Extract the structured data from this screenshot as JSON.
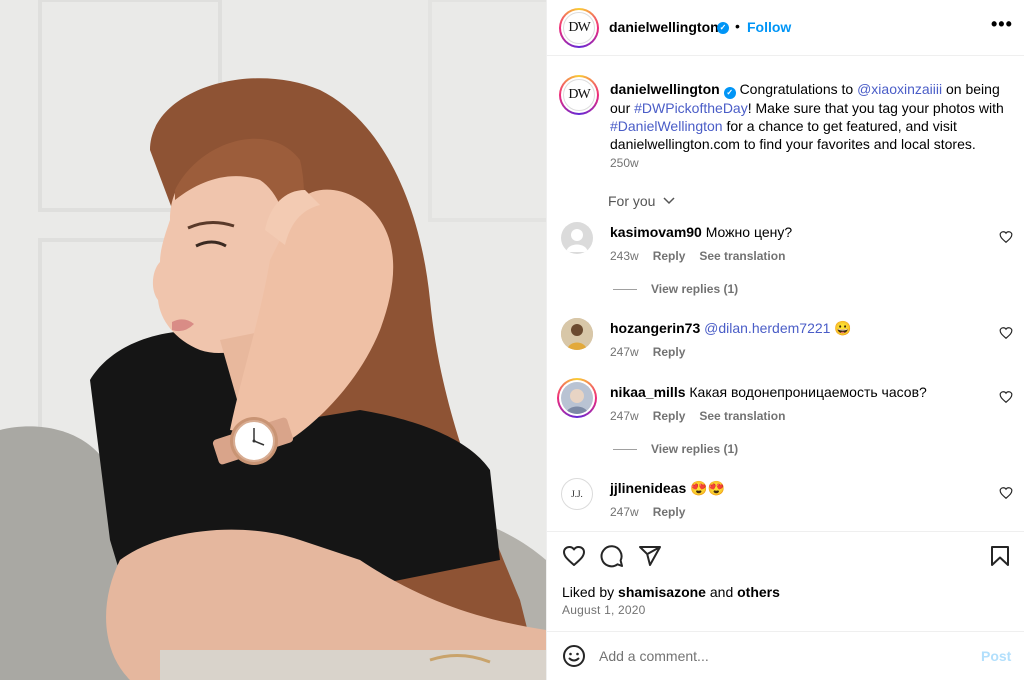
{
  "post": {
    "account": "danielwellington",
    "avatar_letters": "DW",
    "follow_label": "Follow",
    "separator": "•",
    "more_icon": "more-horizontal-icon",
    "verified_icon": "verified-badge-icon"
  },
  "caption": {
    "username": "danielwellington",
    "text_1": "Congratulations to ",
    "mention": "@xiaoxinzaiiii",
    "text_2": " on being our ",
    "hashtag_1": "#DWPickoftheDay",
    "text_3": "! Make sure that you tag your photos with ",
    "hashtag_2": "#DanielWellington",
    "text_4": " for a chance to get featured, and visit danielwellington.com to find your favorites and local stores.",
    "time": "250w"
  },
  "sort": {
    "label": "For you"
  },
  "comments": [
    {
      "username": "kasimovam90",
      "text": "Можно цену?",
      "mention": "",
      "emoji": "",
      "time": "243w",
      "reply_label": "Reply",
      "translation_label": "See translation",
      "view_replies": "View replies (1)"
    },
    {
      "username": "hozangerin73",
      "text": "",
      "mention": "@dilan.herdem7221",
      "emoji": "😀",
      "time": "247w",
      "reply_label": "Reply",
      "translation_label": "",
      "view_replies": ""
    },
    {
      "username": "nikaa_mills",
      "text": "Какая водонепроницаемость часов?",
      "mention": "",
      "emoji": "",
      "time": "247w",
      "reply_label": "Reply",
      "translation_label": "See translation",
      "view_replies": "View replies (1)"
    },
    {
      "username": "jjlinenideas",
      "text": "",
      "mention": "",
      "emoji": "😍😍",
      "time": "247w",
      "reply_label": "Reply",
      "translation_label": "",
      "view_replies": "",
      "avatar_letters": "J.J."
    }
  ],
  "actions": {
    "like_icon": "heart-icon",
    "comment_icon": "comment-icon",
    "share_icon": "send-icon",
    "save_icon": "bookmark-icon"
  },
  "likes": {
    "prefix": "Liked by ",
    "user": "shamisazone",
    "middle": " and ",
    "others": "others"
  },
  "date": "August 1, 2020",
  "add_comment": {
    "placeholder": "Add a comment...",
    "post_label": "Post",
    "emoji_icon": "smiley-icon"
  },
  "colors": {
    "accent": "#0095f6",
    "link": "#4a5dc7",
    "muted": "#737373",
    "post_disabled": "#b2dffc"
  }
}
